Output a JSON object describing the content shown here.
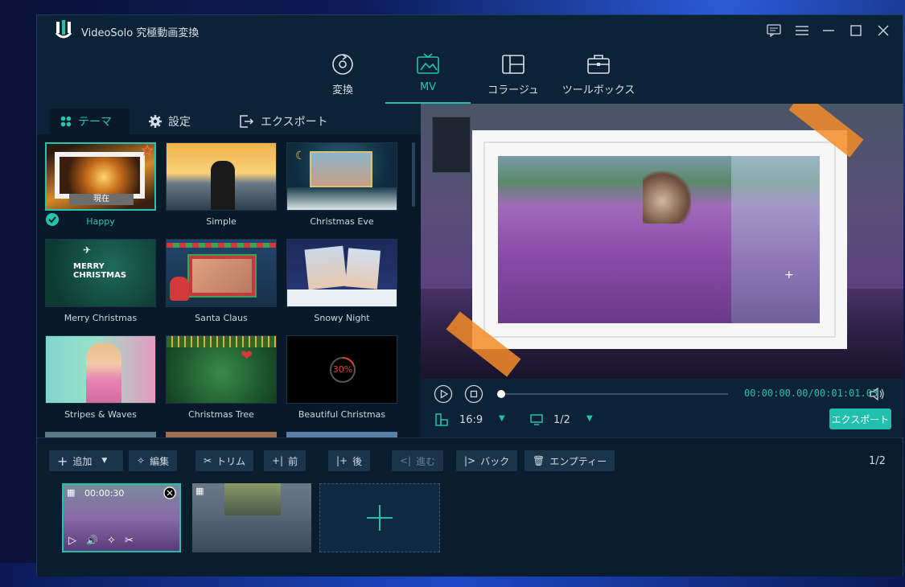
{
  "app": {
    "title": "VideoSolo 究極動画変換"
  },
  "nav": {
    "items": [
      {
        "label": "変換"
      },
      {
        "label": "MV"
      },
      {
        "label": "コラージュ"
      },
      {
        "label": "ツールボックス"
      }
    ]
  },
  "tabs": {
    "theme": "テーマ",
    "settings": "設定",
    "export": "エクスポート"
  },
  "themes": [
    {
      "label": "Happy",
      "badge": "現在"
    },
    {
      "label": "Simple"
    },
    {
      "label": "Christmas Eve"
    },
    {
      "label": "Merry Christmas",
      "overlay_text": "MERRY CHRISTMAS"
    },
    {
      "label": "Santa Claus"
    },
    {
      "label": "Snowy Night"
    },
    {
      "label": "Stripes & Waves"
    },
    {
      "label": "Christmas Tree"
    },
    {
      "label": "Beautiful Christmas",
      "progress_text": "30%"
    }
  ],
  "player": {
    "time": "00:00:00.00/00:01:01.03",
    "aspect": "16:9",
    "page": "1/2",
    "export_label": "エクスポート"
  },
  "toolbar": {
    "add": "追加",
    "edit": "編集",
    "trim": "トリム",
    "before": "前",
    "after": "後",
    "forward": "進む",
    "back": "バック",
    "empty": "エンプティー",
    "page": "1/2"
  },
  "clips": [
    {
      "duration": "00:00:30"
    },
    {
      "duration": ""
    }
  ],
  "colors": {
    "accent": "#20c0ad",
    "bg": "#0c2236",
    "panel": "#08192a"
  }
}
